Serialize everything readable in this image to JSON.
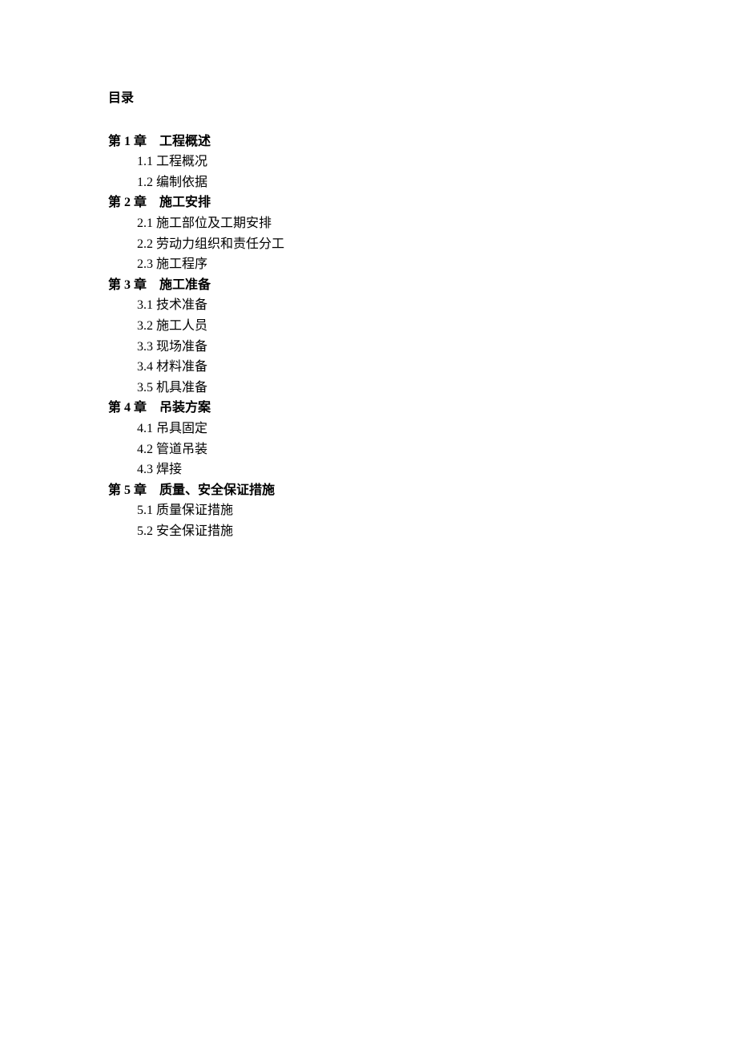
{
  "toc": {
    "title": "目录",
    "chapters": [
      {
        "heading": "第 1 章　工程概述",
        "sections": [
          "1.1 工程概况",
          "1.2 编制依据"
        ]
      },
      {
        "heading": "第 2 章　施工安排",
        "sections": [
          "2.1 施工部位及工期安排",
          "2.2 劳动力组织和责任分工",
          "2.3 施工程序"
        ]
      },
      {
        "heading": "第 3 章　施工准备",
        "sections": [
          "3.1 技术准备",
          "3.2 施工人员",
          "3.3 现场准备",
          "3.4 材料准备",
          "3.5 机具准备"
        ]
      },
      {
        "heading": "第 4 章　吊装方案",
        "sections": [
          "4.1 吊具固定",
          "4.2 管道吊装",
          "4.3 焊接"
        ]
      },
      {
        "heading": "第 5 章　质量、安全保证措施",
        "sections": [
          "5.1 质量保证措施",
          "5.2 安全保证措施"
        ]
      }
    ]
  }
}
